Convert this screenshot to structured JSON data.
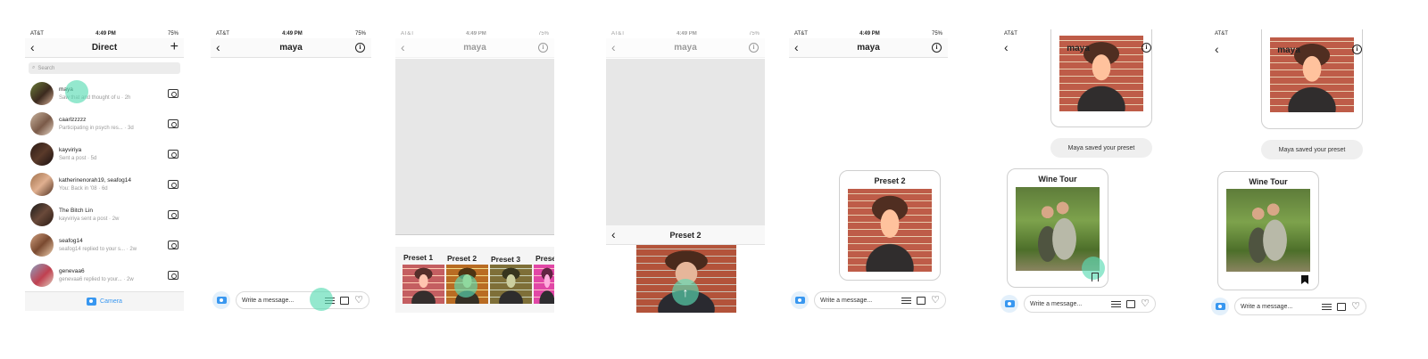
{
  "status": {
    "carrier": "AT&T",
    "time": "4:49 PM",
    "battery": "75%"
  },
  "screen1": {
    "title": "Direct",
    "search_placeholder": "Search",
    "threads": [
      {
        "name": "maya",
        "sub": "Saw that and thought of u · 2h"
      },
      {
        "name": "caarlzzzzz",
        "sub": "Participating in psych res... · 3d"
      },
      {
        "name": "kayviriya",
        "sub": "Sent a post · 5d"
      },
      {
        "name": "katherinenorah19, seafog14",
        "sub": "You: Back in '08 · 6d"
      },
      {
        "name": "The Bitch Lin",
        "sub": "kayviriya sent a post · 2w"
      },
      {
        "name": "seafog14",
        "sub": "seafog14 replied to your s... · 2w"
      },
      {
        "name": "genevaa6",
        "sub": "genevaa6 replied to your... · 2w"
      }
    ],
    "camera_label": "Camera"
  },
  "chat_title": "maya",
  "composer_placeholder": "Write a message...",
  "screen3": {
    "presets": [
      "Preset 1",
      "Preset 2",
      "Preset 3",
      "Prese"
    ]
  },
  "screen4": {
    "preset_title": "Preset 2"
  },
  "screen5": {
    "card_title": "Preset 2"
  },
  "screen6": {
    "saved_msg": "Maya saved your preset",
    "card_title": "Wine Tour"
  },
  "screen7": {
    "saved_msg": "Maya saved your preset",
    "card_title": "Wine Tour"
  },
  "colors": {
    "accent": "#3897f0",
    "tap_highlight": "#5adcb4"
  }
}
